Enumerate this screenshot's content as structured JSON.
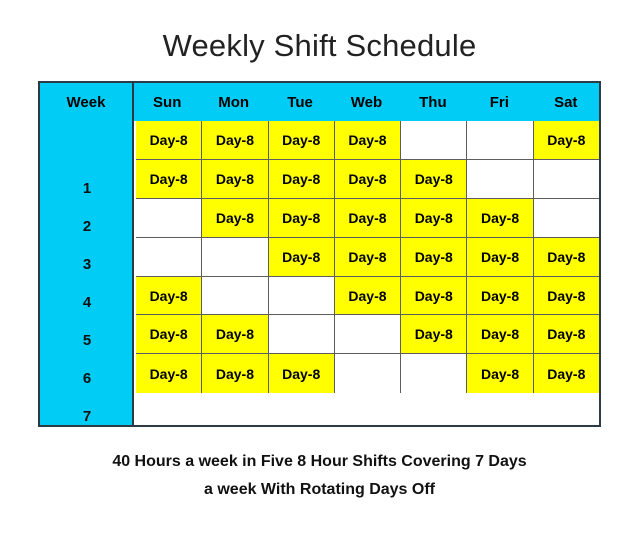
{
  "title": "Weekly Shift Schedule",
  "colors": {
    "header_background": "#00ccf5",
    "week_column_background": "#00ccf5",
    "shift_cell": "#ffff00",
    "off_cell": "#ffffff",
    "table_border": "#2b3a45",
    "cell_border": "#5d5d5d",
    "text": "#000000"
  },
  "table": {
    "week_header": "Week",
    "day_headers": [
      "Sun",
      "Mon",
      "Tue",
      "Web",
      "Thu",
      "Fri",
      "Sat"
    ],
    "shift_label": "Day-8",
    "rows": [
      {
        "week": "1",
        "cells": [
          "Day-8",
          "Day-8",
          "Day-8",
          "Day-8",
          "",
          "",
          "Day-8"
        ]
      },
      {
        "week": "2",
        "cells": [
          "Day-8",
          "Day-8",
          "Day-8",
          "Day-8",
          "Day-8",
          "",
          ""
        ]
      },
      {
        "week": "3",
        "cells": [
          "",
          "Day-8",
          "Day-8",
          "Day-8",
          "Day-8",
          "Day-8",
          ""
        ]
      },
      {
        "week": "4",
        "cells": [
          "",
          "",
          "Day-8",
          "Day-8",
          "Day-8",
          "Day-8",
          "Day-8"
        ]
      },
      {
        "week": "5",
        "cells": [
          "Day-8",
          "",
          "",
          "Day-8",
          "Day-8",
          "Day-8",
          "Day-8"
        ]
      },
      {
        "week": "6",
        "cells": [
          "Day-8",
          "Day-8",
          "",
          "",
          "Day-8",
          "Day-8",
          "Day-8"
        ]
      },
      {
        "week": "7",
        "cells": [
          "Day-8",
          "Day-8",
          "Day-8",
          "",
          "",
          "Day-8",
          "Day-8"
        ]
      }
    ]
  },
  "caption": {
    "line1": "40 Hours a week in Five 8 Hour Shifts Covering 7 Days",
    "line2": "a week With Rotating Days Off"
  }
}
